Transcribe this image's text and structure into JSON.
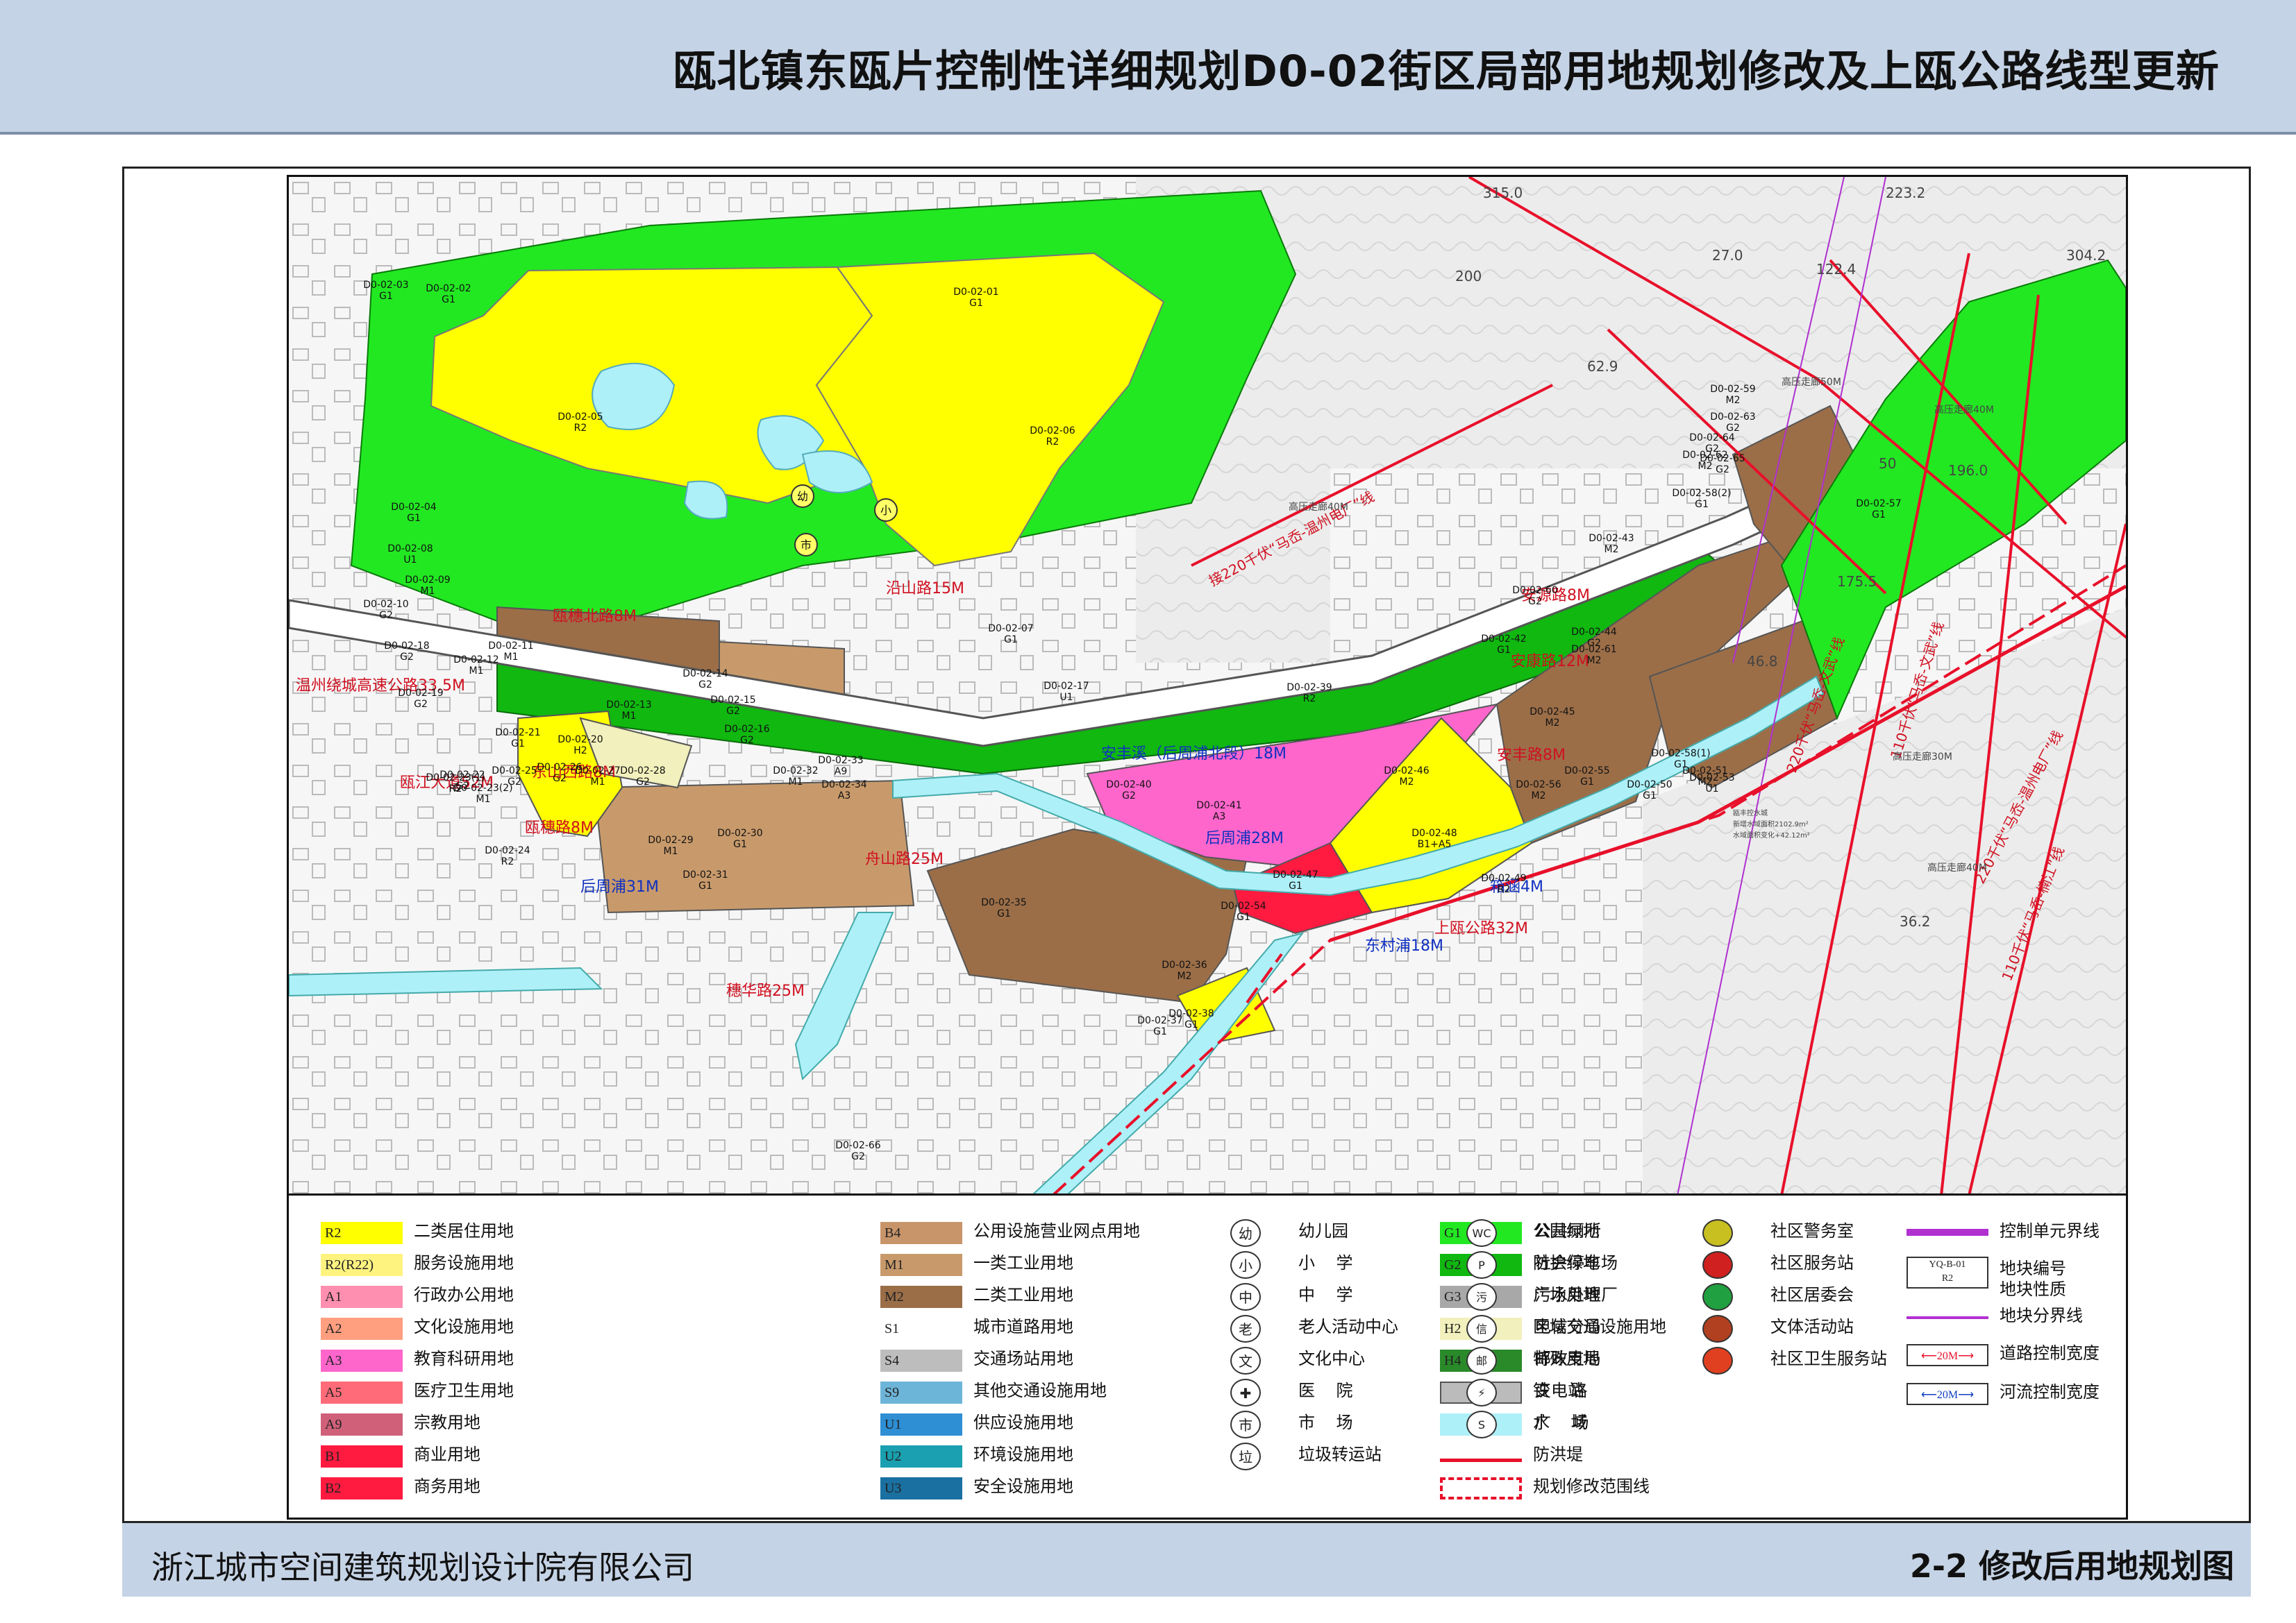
{
  "header": {
    "title": "瓯北镇东瓯片控制性详细规划D0-02街区局部用地规划修改及上瓯公路线型更新"
  },
  "footer": {
    "company": "浙江城市空间建筑规划设计院有限公司",
    "figure_title": "2-2  修改后用地规划图"
  },
  "colors": {
    "R2": "#ffff00",
    "R2(R22)": "#fff380",
    "A1": "#ff8fb0",
    "A2": "#ff9f80",
    "A3": "#ff66cc",
    "A5": "#ff6b78",
    "A9": "#d0607a",
    "B1": "#ff1a40",
    "B2": "#ff1a40",
    "B4": "#c8956b",
    "M1": "#c89a6b",
    "M2": "#9b6e48",
    "S1": "#ffffff",
    "S4": "#bdbdbd",
    "S9": "#6db5d8",
    "U1": "#2e8fd4",
    "U2": "#1aa0b0",
    "U3": "#1a70a0",
    "G1": "#22e822",
    "G2": "#10b810",
    "G3": "#a8a8a8",
    "H2": "#f2f0bc",
    "H4": "#2a8a2a",
    "water": "#aef0f8",
    "flood": "#e8102a"
  },
  "map": {
    "plots": [
      {
        "id": "D0-02-01",
        "code": "G1"
      },
      {
        "id": "D0-02-02",
        "code": "G1"
      },
      {
        "id": "D0-02-03",
        "code": "G1"
      },
      {
        "id": "D0-02-04",
        "code": "G1"
      },
      {
        "id": "D0-02-05",
        "code": "R2"
      },
      {
        "id": "D0-02-06",
        "code": "R2"
      },
      {
        "id": "D0-02-07",
        "code": "G1"
      },
      {
        "id": "D0-02-08",
        "code": "U1"
      },
      {
        "id": "D0-02-09",
        "code": "M1"
      },
      {
        "id": "D0-02-10",
        "code": "G2"
      },
      {
        "id": "D0-02-11",
        "code": "M1"
      },
      {
        "id": "D0-02-12",
        "code": "M1"
      },
      {
        "id": "D0-02-13",
        "code": "M1"
      },
      {
        "id": "D0-02-14",
        "code": "G2"
      },
      {
        "id": "D0-02-15",
        "code": "G2"
      },
      {
        "id": "D0-02-16",
        "code": "G2"
      },
      {
        "id": "D0-02-17",
        "code": "U1"
      },
      {
        "id": "D0-02-18",
        "code": "G2"
      },
      {
        "id": "D0-02-19",
        "code": "G2"
      },
      {
        "id": "D0-02-20",
        "code": "H2"
      },
      {
        "id": "D0-02-21",
        "code": "G1"
      },
      {
        "id": "D0-02-22",
        "code": "G2"
      },
      {
        "id": "D0-02-23(1)",
        "code": "R2"
      },
      {
        "id": "D0-02-23(2)",
        "code": "M1"
      },
      {
        "id": "D0-02-24",
        "code": "R2"
      },
      {
        "id": "D0-02-25",
        "code": "G2"
      },
      {
        "id": "D0-02-26",
        "code": "G2"
      },
      {
        "id": "D0-02-27",
        "code": "M1"
      },
      {
        "id": "D0-02-28",
        "code": "G2"
      },
      {
        "id": "D0-02-29",
        "code": "M1"
      },
      {
        "id": "D0-02-30",
        "code": "G1"
      },
      {
        "id": "D0-02-31",
        "code": "G1"
      },
      {
        "id": "D0-02-32",
        "code": "M1"
      },
      {
        "id": "D0-02-33",
        "code": "A9"
      },
      {
        "id": "D0-02-34",
        "code": "A3"
      },
      {
        "id": "D0-02-35",
        "code": "G1"
      },
      {
        "id": "D0-02-36",
        "code": "M2"
      },
      {
        "id": "D0-02-37",
        "code": "G1"
      },
      {
        "id": "D0-02-38",
        "code": "G1"
      },
      {
        "id": "D0-02-39",
        "code": "R2"
      },
      {
        "id": "D0-02-40",
        "code": "G2"
      },
      {
        "id": "D0-02-41",
        "code": "A3"
      },
      {
        "id": "D0-02-42",
        "code": "G1"
      },
      {
        "id": "D0-02-43",
        "code": "M2"
      },
      {
        "id": "D0-02-44",
        "code": "G2"
      },
      {
        "id": "D0-02-45",
        "code": "M2"
      },
      {
        "id": "D0-02-46",
        "code": "M2"
      },
      {
        "id": "D0-02-47",
        "code": "G1"
      },
      {
        "id": "D0-02-48",
        "code": "B1+A5"
      },
      {
        "id": "D0-02-49",
        "code": "R2"
      },
      {
        "id": "D0-02-50",
        "code": "G1"
      },
      {
        "id": "D0-02-51",
        "code": "M2"
      },
      {
        "id": "D0-02-53",
        "code": "U1"
      },
      {
        "id": "D0-02-54",
        "code": "G1"
      },
      {
        "id": "D0-02-55",
        "code": "G1"
      },
      {
        "id": "D0-02-56",
        "code": "M2"
      },
      {
        "id": "D0-02-57",
        "code": "G1"
      },
      {
        "id": "D0-02-58(1)",
        "code": "G1"
      },
      {
        "id": "D0-02-58(2)",
        "code": "G1"
      },
      {
        "id": "D0-02-59",
        "code": "M2"
      },
      {
        "id": "D0-02-60",
        "code": "G2"
      },
      {
        "id": "D0-02-61",
        "code": "M2"
      },
      {
        "id": "D0-02-62",
        "code": "M2"
      },
      {
        "id": "D0-02-63",
        "code": "G2"
      },
      {
        "id": "D0-02-64",
        "code": "G2"
      },
      {
        "id": "D0-02-65",
        "code": "G2"
      },
      {
        "id": "D0-02-66",
        "code": "G2"
      }
    ],
    "roads": [
      "沿山路15M",
      "瓯穗北路8M",
      "温州绕城高速公路33.5M",
      "瓯江大道52M",
      "东山西路8M",
      "瓯穗路8M",
      "后周浦31M",
      "舟山路25M",
      "穗华路25M",
      "安丰溪（后周浦北段）18M",
      "后周浦28M",
      "东村浦18M",
      "上瓯公路32M",
      "箱涵4M",
      "安丰路8M",
      "安康路12M",
      "安源路8M"
    ],
    "power_lines": [
      "接220千伏“马岙-温州电厂”线",
      "220千伏“马岙-文武”线",
      "110千伏“马岙-文武”线",
      "220千伏“马岙-温州电厂”线",
      "110千伏“马岙-楠江”线"
    ],
    "corridors": [
      "高压走廊40M",
      "高压走廊50M",
      "高压走廊40M",
      "高压走廊30M",
      "高压走廊40M"
    ],
    "elevations": [
      "315.0",
      "223.2",
      "200",
      "27.0",
      "122.4",
      "304.2",
      "62.9",
      "196.0",
      "50",
      "175.5",
      "46.8",
      "36.2"
    ],
    "notes": [
      "瓯丰控水城",
      "新增水域面积2102.9m²",
      "水域面积变化+42.12m²"
    ],
    "school_icons": [
      "幼",
      "小",
      "市"
    ]
  },
  "legend": {
    "landuse": [
      {
        "code": "R2",
        "label": "二类居住用地"
      },
      {
        "code": "R2(R22)",
        "label": "服务设施用地"
      },
      {
        "code": "A1",
        "label": "行政办公用地"
      },
      {
        "code": "A2",
        "label": "文化设施用地"
      },
      {
        "code": "A3",
        "label": "教育科研用地"
      },
      {
        "code": "A5",
        "label": "医疗卫生用地"
      },
      {
        "code": "A9",
        "label": "宗教用地"
      },
      {
        "code": "B1",
        "label": "商业用地"
      },
      {
        "code": "B2",
        "label": "商务用地"
      },
      {
        "code": "B4",
        "label": "公用设施营业网点用地"
      },
      {
        "code": "M1",
        "label": "一类工业用地"
      },
      {
        "code": "M2",
        "label": "二类工业用地"
      },
      {
        "code": "S1",
        "label": "城市道路用地"
      },
      {
        "code": "S4",
        "label": "交通场站用地"
      },
      {
        "code": "S9",
        "label": "其他交通设施用地"
      },
      {
        "code": "U1",
        "label": "供应设施用地"
      },
      {
        "code": "U2",
        "label": "环境设施用地"
      },
      {
        "code": "U3",
        "label": "安全设施用地"
      },
      {
        "code": "G1",
        "label": "公园绿地"
      },
      {
        "code": "G2",
        "label": "防护绿地"
      },
      {
        "code": "G3",
        "label": "广场用地"
      },
      {
        "code": "H2",
        "label": "区域交通设施用地"
      },
      {
        "code": "H4",
        "label": "特殊用地"
      },
      {
        "code": "",
        "label": "铁    路"
      },
      {
        "code": "",
        "label": "水    域"
      },
      {
        "code": "",
        "label": "防洪堤"
      },
      {
        "code": "",
        "label": "规划修改范围线"
      }
    ],
    "facilities_a": [
      {
        "glyph": "幼",
        "label": "幼儿园"
      },
      {
        "glyph": "小",
        "label": "小    学"
      },
      {
        "glyph": "中",
        "label": "中    学"
      },
      {
        "glyph": "老",
        "label": "老人活动中心"
      },
      {
        "glyph": "文",
        "label": "文化中心"
      },
      {
        "glyph": "✚",
        "label": "医    院"
      },
      {
        "glyph": "市",
        "label": "市    场"
      },
      {
        "glyph": "垃",
        "label": "垃圾转运站"
      }
    ],
    "facilities_b": [
      {
        "glyph": "WC",
        "label": "公共厕所"
      },
      {
        "glyph": "P",
        "label": "社会停车场"
      },
      {
        "glyph": "污",
        "label": "污水处理厂"
      },
      {
        "glyph": "信",
        "label": "电信分局"
      },
      {
        "glyph": "邮",
        "label": "邮政支局"
      },
      {
        "glyph": "⚡",
        "label": "变电站"
      },
      {
        "glyph": "S",
        "label": "广    场"
      }
    ],
    "community": [
      {
        "label": "社区警务室"
      },
      {
        "label": "社区服务站"
      },
      {
        "label": "社区居委会"
      },
      {
        "label": "文体活动站"
      },
      {
        "label": "社区卫生服务站"
      }
    ],
    "lines": [
      {
        "label": "控制单元界线"
      },
      {
        "label": "地块编号\n地块性质",
        "sample_id": "YQ-B-01",
        "sample_code": "R2"
      },
      {
        "label": "地块分界线"
      },
      {
        "label": "道路控制宽度",
        "sample_width": "20M"
      },
      {
        "label": "河流控制宽度",
        "sample_width": "20M"
      }
    ]
  }
}
